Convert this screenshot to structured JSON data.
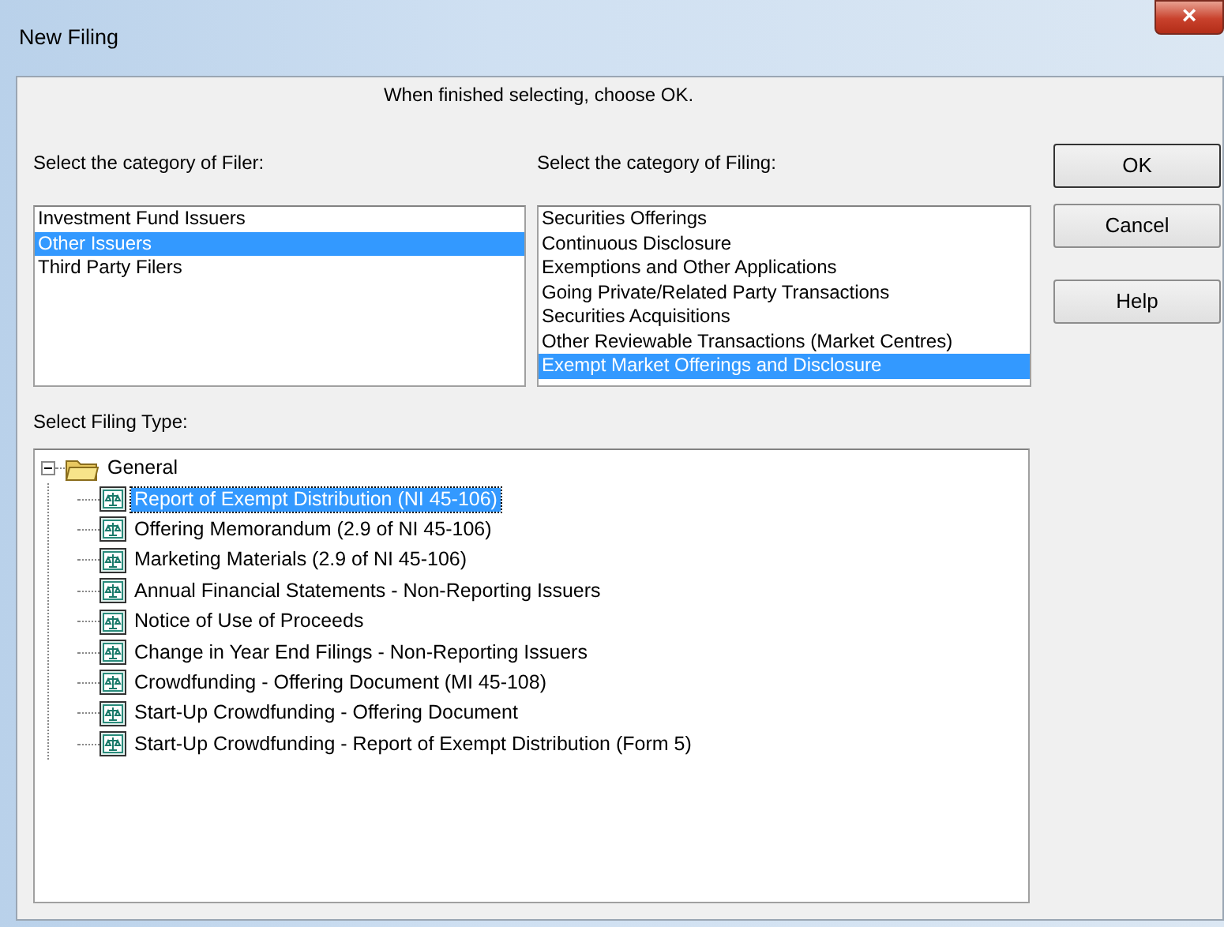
{
  "window": {
    "title": "New Filing",
    "close": "×"
  },
  "instruction": "When finished selecting, choose OK.",
  "filer": {
    "label": "Select the category of Filer:",
    "items": [
      {
        "label": "Investment Fund Issuers",
        "selected": false
      },
      {
        "label": "Other Issuers",
        "selected": true
      },
      {
        "label": "Third Party Filers",
        "selected": false
      }
    ]
  },
  "filing": {
    "label": "Select the category of Filing:",
    "items": [
      {
        "label": "Securities Offerings",
        "selected": false
      },
      {
        "label": "Continuous Disclosure",
        "selected": false
      },
      {
        "label": "Exemptions and Other Applications",
        "selected": false
      },
      {
        "label": "Going Private/Related Party Transactions",
        "selected": false
      },
      {
        "label": "Securities Acquisitions",
        "selected": false
      },
      {
        "label": "Other Reviewable Transactions (Market Centres)",
        "selected": false
      },
      {
        "label": "Exempt Market Offerings and Disclosure",
        "selected": true
      }
    ]
  },
  "buttons": [
    "OK",
    "Cancel",
    "Help"
  ],
  "filing_type": {
    "label": "Select Filing Type:",
    "tree": [
      {
        "label": "General",
        "expanded": true,
        "selected": false,
        "children": [
          {
            "label": "Report of Exempt Distribution (NI 45-106)",
            "selected": true
          },
          {
            "label": "Offering Memorandum (2.9 of NI 45-106)",
            "selected": false
          },
          {
            "label": "Marketing Materials (2.9 of NI 45-106)",
            "selected": false
          },
          {
            "label": "Annual Financial Statements - Non-Reporting Issuers",
            "selected": false
          },
          {
            "label": "Notice of Use of Proceeds",
            "selected": false
          },
          {
            "label": "Change in Year End Filings - Non-Reporting Issuers",
            "selected": false
          },
          {
            "label": "Crowdfunding - Offering Document (MI 45-108)",
            "selected": false
          },
          {
            "label": "Start-Up Crowdfunding - Offering Document",
            "selected": false
          },
          {
            "label": "Start-Up Crowdfunding - Report of Exempt Distribution (Form 5)",
            "selected": false
          }
        ]
      }
    ]
  }
}
